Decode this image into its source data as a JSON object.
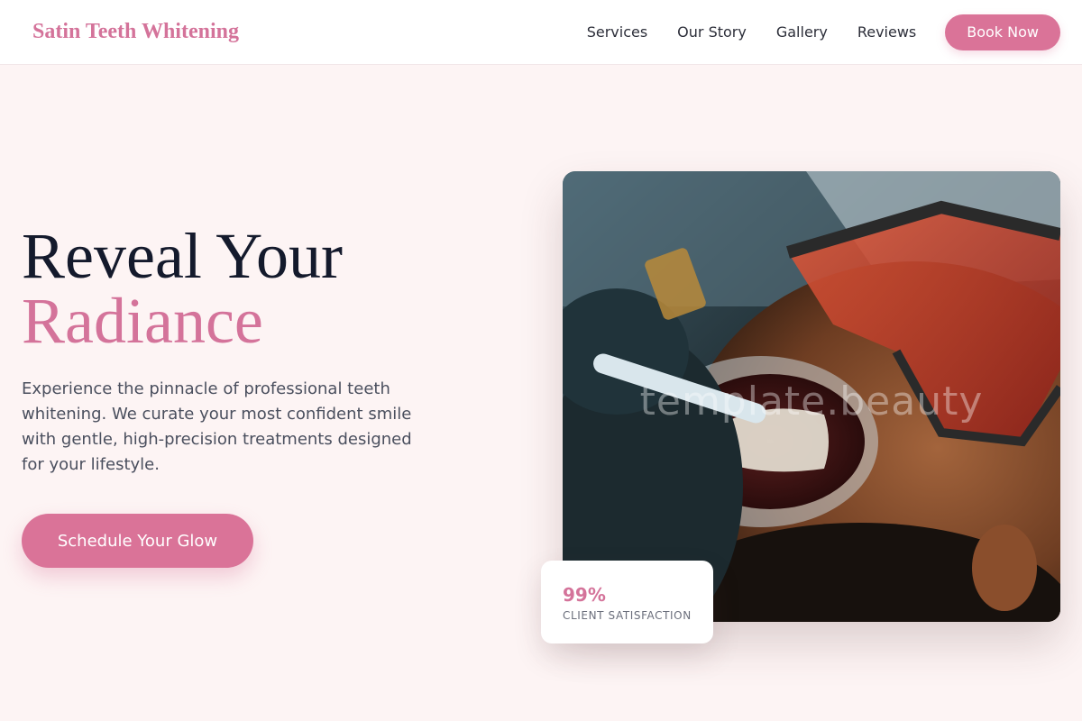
{
  "nav": {
    "brand": "Satin Teeth Whitening",
    "links": [
      {
        "label": "Services"
      },
      {
        "label": "Our Story"
      },
      {
        "label": "Gallery"
      },
      {
        "label": "Reviews"
      }
    ],
    "cta_label": "Book Now"
  },
  "hero": {
    "title_line1": "Reveal Your",
    "title_line2": "Radiance",
    "description": "Experience the pinnacle of professional teeth whitening. We curate your most confident smile with gentle, high-precision treatments designed for your lifestyle.",
    "cta_label": "Schedule Your Glow"
  },
  "image": {
    "watermark": "template.beauty"
  },
  "stat": {
    "value": "99%",
    "label": "CLIENT SATISFACTION"
  },
  "colors": {
    "accent": "#da7398",
    "background": "#fdf4f4",
    "heading": "#141a2c"
  }
}
